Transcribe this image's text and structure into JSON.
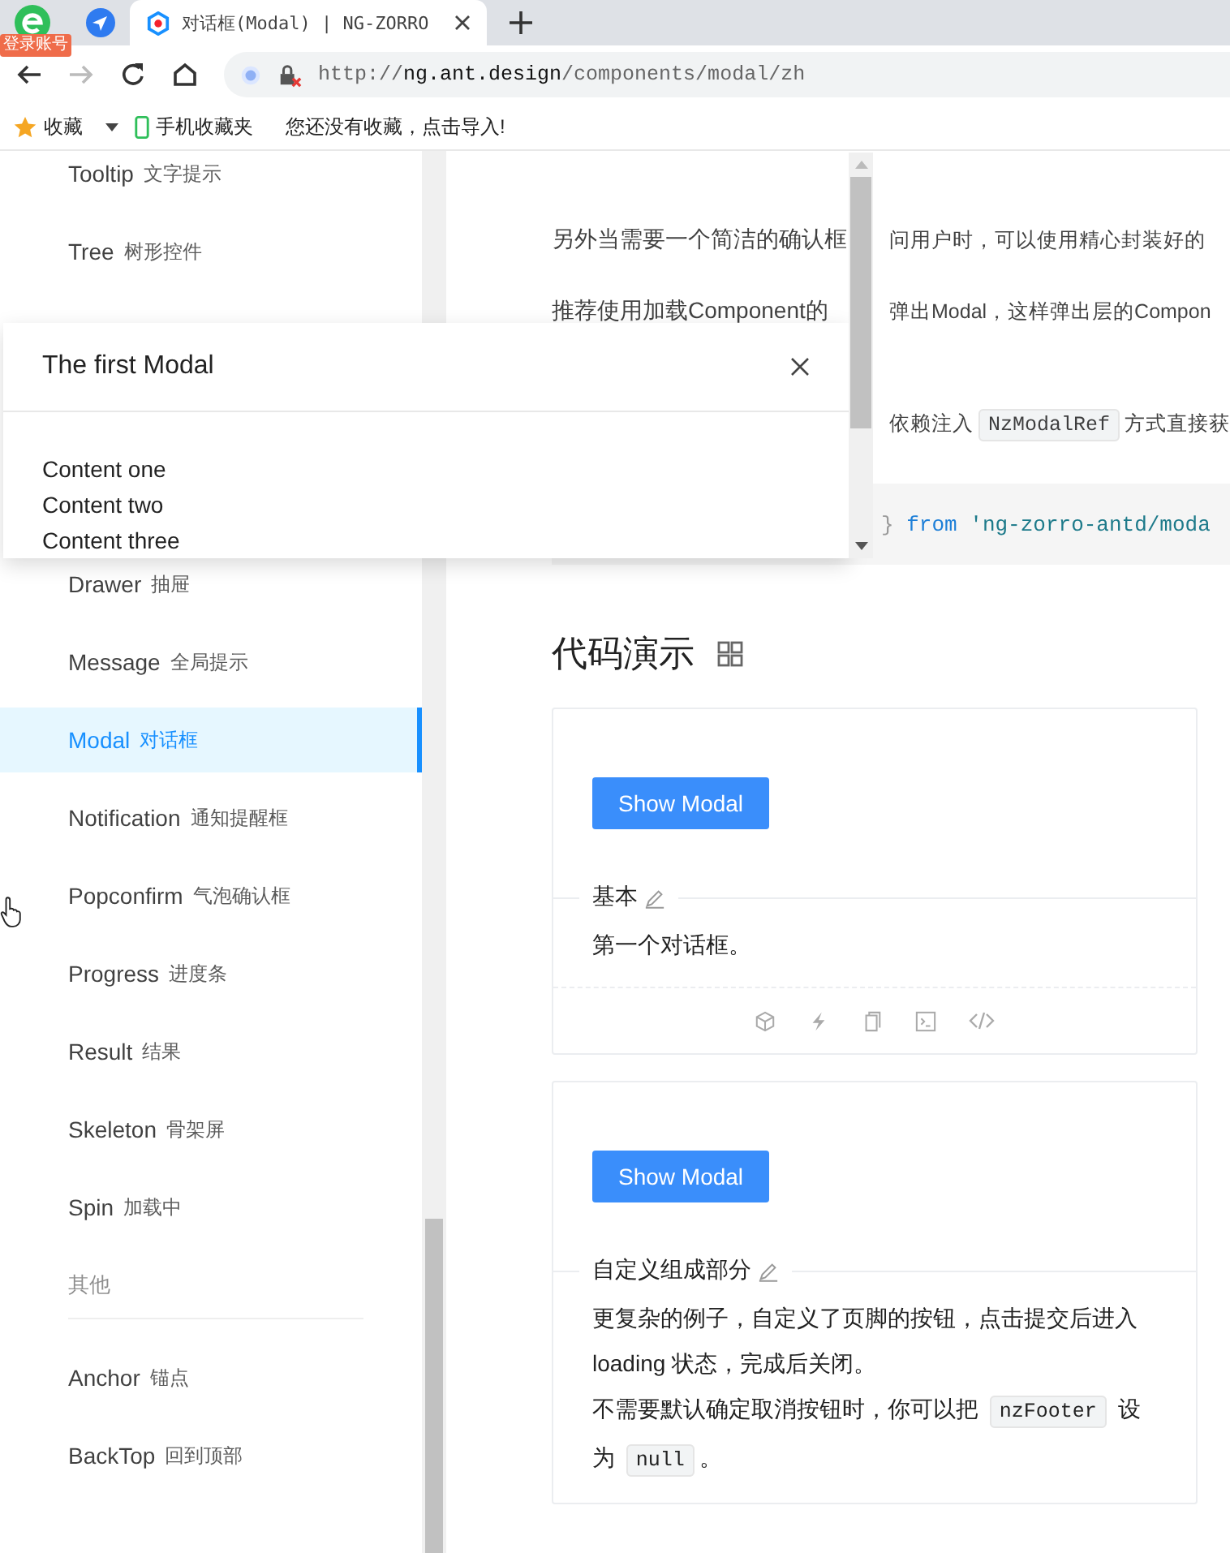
{
  "browser": {
    "account_badge": "登录账号",
    "tabs": [
      {
        "title": "对话框(Modal) | NG-ZORRO",
        "selected": true
      }
    ],
    "forward_disabled": true,
    "url": {
      "scheme": "http://",
      "host": "ng.ant.design",
      "path": "/components/modal/zh"
    },
    "bookmarks": [
      {
        "kind": "star",
        "label": "收藏",
        "menu": true
      },
      {
        "kind": "phone",
        "label": "手机收藏夹",
        "menu": false
      }
    ],
    "bookmark_hint": "您还没有收藏，点击导入!"
  },
  "sidebar": {
    "items_above": [
      {
        "kind": "item",
        "label": "Tooltip",
        "sub": "文字提示",
        "selected": false
      },
      {
        "kind": "item",
        "label": "Tree",
        "sub": "树形控件",
        "selected": false
      }
    ],
    "items_below": [
      {
        "kind": "item",
        "label": "Drawer",
        "sub": "抽屉",
        "selected": false
      },
      {
        "kind": "item",
        "label": "Message",
        "sub": "全局提示",
        "selected": false
      },
      {
        "kind": "item",
        "label": "Modal",
        "sub": "对话框",
        "selected": true
      },
      {
        "kind": "item",
        "label": "Notification",
        "sub": "通知提醒框",
        "selected": false
      },
      {
        "kind": "item",
        "label": "Popconfirm",
        "sub": "气泡确认框",
        "selected": false
      },
      {
        "kind": "item",
        "label": "Progress",
        "sub": "进度条",
        "selected": false
      },
      {
        "kind": "item",
        "label": "Result",
        "sub": "结果",
        "selected": false
      },
      {
        "kind": "item",
        "label": "Skeleton",
        "sub": "骨架屏",
        "selected": false
      },
      {
        "kind": "item",
        "label": "Spin",
        "sub": "加载中",
        "selected": false
      },
      {
        "kind": "group",
        "label": "其他"
      },
      {
        "kind": "item",
        "label": "Anchor",
        "sub": "锚点",
        "selected": false
      },
      {
        "kind": "item",
        "label": "BackTop",
        "sub": "回到顶部",
        "selected": false
      }
    ]
  },
  "intro": [
    {
      "left": "另外当需要一个简洁的确认框",
      "right": [
        {
          "kind": "text",
          "text": "问用户时，可以使用精心封装好的"
        }
      ]
    },
    {
      "left": "推荐使用加载Component的",
      "right": [
        {
          "kind": "text",
          "text": "弹出Modal，这样弹出层的Compon"
        }
      ]
    },
    {
      "right": [
        {
          "kind": "text",
          "text": "依赖注入"
        },
        {
          "kind": "code",
          "text": "NzModalRef"
        },
        {
          "kind": "text",
          "text": "方式直接获"
        }
      ]
    }
  ],
  "code_line": [
    {
      "kind": "punct",
      "text": "}"
    },
    {
      "kind": "keyword",
      "text": "from"
    },
    {
      "kind": "string",
      "text": "'ng-zorro-antd/moda"
    }
  ],
  "section_title": "代码演示",
  "demos": [
    {
      "button": "Show Modal",
      "title": "基本",
      "paragraphs": [
        [
          {
            "kind": "text",
            "text": "第一个对话框。"
          }
        ]
      ],
      "actions": true
    },
    {
      "button": "Show Modal",
      "title": "自定义组成部分",
      "paragraphs": [
        [
          {
            "kind": "text",
            "text": "更复杂的例子，自定义了页脚的按钮，点击提交后进入loading 状态，完成后关闭。"
          }
        ],
        [
          {
            "kind": "text",
            "text": "不需要默认确定取消按钮时，你可以把 "
          },
          {
            "kind": "code",
            "text": "nzFooter"
          },
          {
            "kind": "text",
            "text": " 设为 "
          },
          {
            "kind": "code",
            "text": "null"
          },
          {
            "kind": "text",
            "text": "。"
          }
        ]
      ],
      "actions": false
    }
  ],
  "modal": {
    "title": "The first Modal",
    "lines": [
      "Content one",
      "Content two",
      "Content three"
    ]
  }
}
